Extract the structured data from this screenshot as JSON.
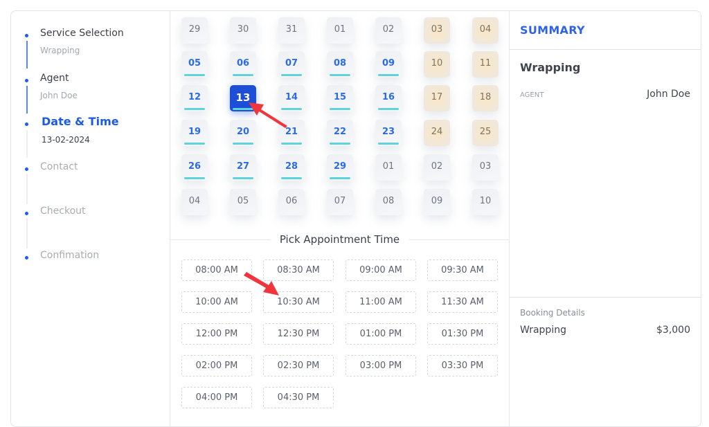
{
  "steps": [
    {
      "title": "Service Selection",
      "sub": "Wrapping",
      "state": "done"
    },
    {
      "title": "Agent",
      "sub": "John Doe",
      "state": "done"
    },
    {
      "title": "Date & Time",
      "sub": "13-02-2024",
      "state": "active"
    },
    {
      "title": "Contact",
      "sub": "",
      "state": "pending"
    },
    {
      "title": "Checkout",
      "sub": "",
      "state": "pending"
    },
    {
      "title": "Confimation",
      "sub": "",
      "state": "pending"
    }
  ],
  "calendar": {
    "selected": "13",
    "weeks": [
      [
        {
          "d": "29",
          "t": "muted"
        },
        {
          "d": "30",
          "t": "muted"
        },
        {
          "d": "31",
          "t": "muted"
        },
        {
          "d": "01",
          "t": "muted"
        },
        {
          "d": "02",
          "t": "muted"
        },
        {
          "d": "03",
          "t": "weekend"
        },
        {
          "d": "04",
          "t": "weekend"
        }
      ],
      [
        {
          "d": "05",
          "t": "available"
        },
        {
          "d": "06",
          "t": "available"
        },
        {
          "d": "07",
          "t": "available"
        },
        {
          "d": "08",
          "t": "available"
        },
        {
          "d": "09",
          "t": "available"
        },
        {
          "d": "10",
          "t": "weekend"
        },
        {
          "d": "11",
          "t": "weekend"
        }
      ],
      [
        {
          "d": "12",
          "t": "available"
        },
        {
          "d": "13",
          "t": "selected"
        },
        {
          "d": "14",
          "t": "available"
        },
        {
          "d": "15",
          "t": "available"
        },
        {
          "d": "16",
          "t": "available"
        },
        {
          "d": "17",
          "t": "weekend"
        },
        {
          "d": "18",
          "t": "weekend"
        }
      ],
      [
        {
          "d": "19",
          "t": "available"
        },
        {
          "d": "20",
          "t": "available"
        },
        {
          "d": "21",
          "t": "available"
        },
        {
          "d": "22",
          "t": "available"
        },
        {
          "d": "23",
          "t": "available"
        },
        {
          "d": "24",
          "t": "weekend"
        },
        {
          "d": "25",
          "t": "weekend"
        }
      ],
      [
        {
          "d": "26",
          "t": "available"
        },
        {
          "d": "27",
          "t": "available"
        },
        {
          "d": "28",
          "t": "available"
        },
        {
          "d": "29",
          "t": "available"
        },
        {
          "d": "01",
          "t": "muted"
        },
        {
          "d": "02",
          "t": "muted"
        },
        {
          "d": "03",
          "t": "muted"
        }
      ],
      [
        {
          "d": "04",
          "t": "muted"
        },
        {
          "d": "05",
          "t": "muted"
        },
        {
          "d": "06",
          "t": "muted"
        },
        {
          "d": "07",
          "t": "muted"
        },
        {
          "d": "08",
          "t": "muted"
        },
        {
          "d": "09",
          "t": "muted"
        },
        {
          "d": "10",
          "t": "muted"
        }
      ]
    ]
  },
  "time": {
    "heading": "Pick Appointment Time",
    "slots": [
      "08:00 AM",
      "08:30 AM",
      "09:00 AM",
      "09:30 AM",
      "10:00 AM",
      "10:30 AM",
      "11:00 AM",
      "11:30 AM",
      "12:00 PM",
      "12:30 PM",
      "01:00 PM",
      "01:30 PM",
      "02:00 PM",
      "02:30 PM",
      "03:00 PM",
      "03:30 PM",
      "04:00 PM",
      "04:30 PM"
    ]
  },
  "summary": {
    "title": "SUMMARY",
    "service": "Wrapping",
    "agent_label": "AGENT",
    "agent_value": "John Doe",
    "booking_label": "Booking Details",
    "booking_item": "Wrapping",
    "booking_price": "$3,000"
  },
  "colors": {
    "accent": "#1d5ae6",
    "selected_day": "#1d4ed8",
    "available_underline": "#5fd3dc",
    "annotation_arrow": "#f0353b"
  }
}
